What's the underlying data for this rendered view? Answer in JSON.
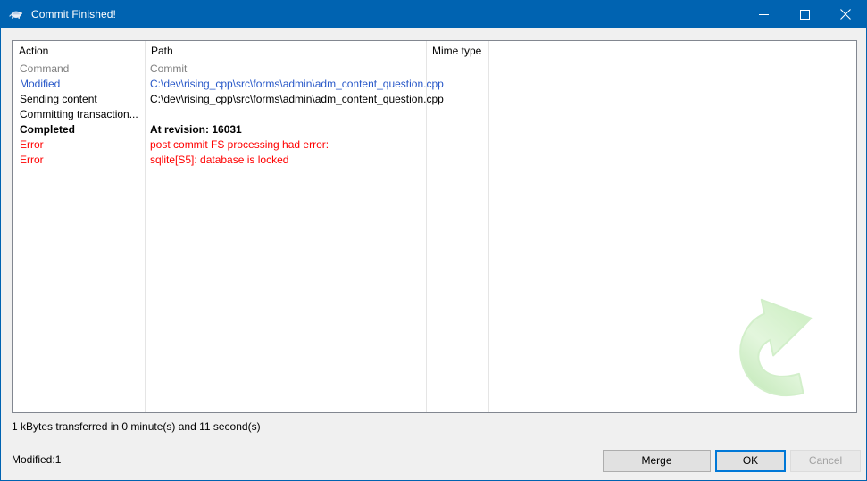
{
  "window": {
    "title": "Commit Finished!",
    "icon": "tortoise-icon",
    "accent_color": "#0063b1",
    "controls": [
      {
        "name": "minimize",
        "glyph": "minimize-icon"
      },
      {
        "name": "maximize",
        "glyph": "maximize-icon"
      },
      {
        "name": "close",
        "glyph": "close-icon"
      }
    ]
  },
  "list": {
    "columns": [
      {
        "key": "action",
        "label": "Action"
      },
      {
        "key": "path",
        "label": "Path"
      },
      {
        "key": "mime",
        "label": "Mime type"
      }
    ],
    "rows": [
      {
        "action": "Command",
        "path": "Commit",
        "style": "grey"
      },
      {
        "action": "Modified",
        "path": "C:\\dev\\rising_cpp\\src\\forms\\admin\\adm_content_question.cpp",
        "style": "blue"
      },
      {
        "action": "Sending content",
        "path": "C:\\dev\\rising_cpp\\src\\forms\\admin\\adm_content_question.cpp",
        "style": "black"
      },
      {
        "action": "Committing transaction...",
        "path": "",
        "style": "black"
      },
      {
        "action": "Completed",
        "path": "At revision: 16031",
        "style": "bold"
      },
      {
        "action": "Error",
        "path": "post commit FS processing had error:",
        "style": "red"
      },
      {
        "action": "Error",
        "path": "sqlite[S5]: database is locked",
        "style": "red"
      }
    ]
  },
  "status": {
    "transfer": "1 kBytes transferred in 0 minute(s) and 11 second(s)",
    "counts": "Modified:1"
  },
  "buttons": {
    "merge": "Merge",
    "ok": "OK",
    "cancel": "Cancel"
  },
  "watermark": {
    "icon": "curved-arrow-icon",
    "color": "#d6f0cf"
  }
}
